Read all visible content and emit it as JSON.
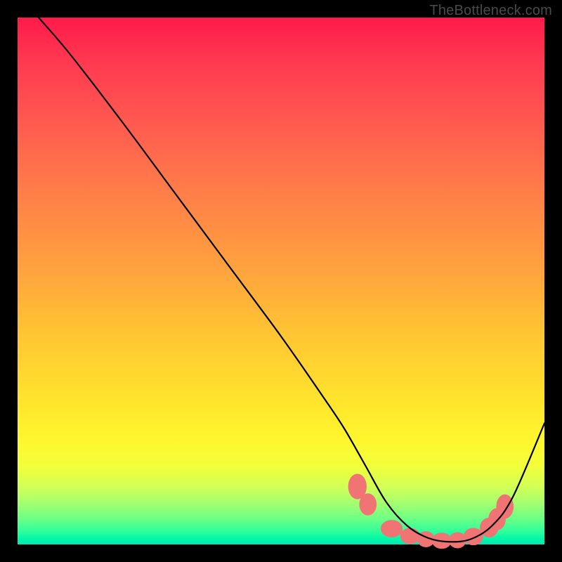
{
  "watermark": "TheBottleneck.com",
  "chart_data": {
    "type": "line",
    "title": "",
    "xlabel": "",
    "ylabel": "",
    "xlim": [
      0,
      100
    ],
    "ylim": [
      0,
      100
    ],
    "series": [
      {
        "name": "curve",
        "x": [
          4,
          10,
          20,
          30,
          40,
          50,
          58,
          62,
          66,
          70,
          74,
          78,
          82,
          86,
          90,
          94,
          100
        ],
        "y": [
          100,
          93,
          80,
          66.5,
          53,
          39.5,
          28,
          22,
          15,
          8,
          3.5,
          1.2,
          0.5,
          1.0,
          3.5,
          9,
          23
        ]
      }
    ],
    "markers": {
      "name": "red-dots",
      "color": "#f07474",
      "points": [
        {
          "x": 64.5,
          "y": 11.0,
          "rx": 3.2,
          "ry": 4.4
        },
        {
          "x": 66.5,
          "y": 7.6,
          "rx": 3.0,
          "ry": 3.8
        },
        {
          "x": 71.0,
          "y": 3.0,
          "rx": 3.8,
          "ry": 3.0
        },
        {
          "x": 74.5,
          "y": 1.6,
          "rx": 3.4,
          "ry": 2.8
        },
        {
          "x": 77.5,
          "y": 1.0,
          "rx": 3.0,
          "ry": 2.8
        },
        {
          "x": 80.5,
          "y": 0.7,
          "rx": 3.4,
          "ry": 2.8
        },
        {
          "x": 83.5,
          "y": 0.8,
          "rx": 3.0,
          "ry": 2.8
        },
        {
          "x": 86.5,
          "y": 1.5,
          "rx": 3.4,
          "ry": 3.0
        },
        {
          "x": 89.5,
          "y": 3.2,
          "rx": 3.2,
          "ry": 3.4
        },
        {
          "x": 91.0,
          "y": 4.8,
          "rx": 3.0,
          "ry": 3.8
        },
        {
          "x": 92.5,
          "y": 7.2,
          "rx": 3.0,
          "ry": 4.2
        }
      ]
    }
  }
}
